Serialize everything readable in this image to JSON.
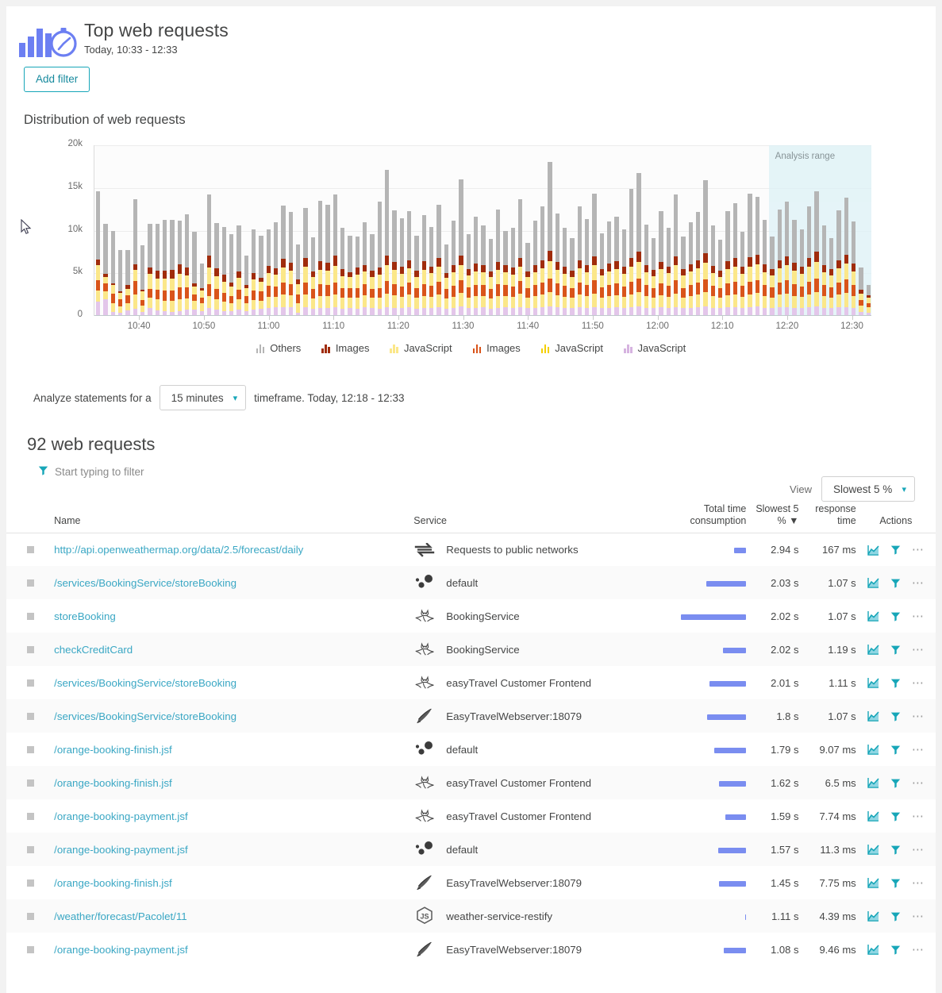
{
  "header": {
    "title": "Top web requests",
    "subtitle": "Today, 10:33 - 12:33",
    "icon": "bar-chart-stopwatch-icon",
    "add_filter_label": "Add filter"
  },
  "chart_section": {
    "title": "Distribution of web requests"
  },
  "chart_data": {
    "type": "bar",
    "stacked": true,
    "title": "Distribution of web requests",
    "xlabel": "",
    "ylabel": "",
    "ylim": [
      0,
      20000
    ],
    "ytick_labels": [
      "0",
      "5k",
      "10k",
      "15k",
      "20k"
    ],
    "ytick_values": [
      0,
      5000,
      10000,
      15000,
      20000
    ],
    "xtick_labels": [
      "10:40",
      "10:50",
      "11:00",
      "11:10",
      "11:20",
      "11:30",
      "11:40",
      "11:50",
      "12:00",
      "12:10",
      "12:20",
      "12:30"
    ],
    "grid": true,
    "legend_position": "bottom",
    "annotation": "Analysis range",
    "analysis_range": {
      "start": "12:18",
      "end": "12:33"
    },
    "series": [
      {
        "name": "JavaScript",
        "key": "s1",
        "color": "#e3c6ea"
      },
      {
        "name": "JavaScript",
        "key": "s2",
        "color": "#fbe789"
      },
      {
        "name": "Images",
        "key": "s3",
        "color": "#d9541a"
      },
      {
        "name": "JavaScript",
        "key": "s4",
        "color": "#fbe789"
      },
      {
        "name": "Images",
        "key": "s5",
        "color": "#a02c0c"
      },
      {
        "name": "Others",
        "key": "s6",
        "color": "#b5b5b5"
      }
    ],
    "legend": [
      {
        "label": "Others",
        "color": "#b5b5b5"
      },
      {
        "label": "Images",
        "color": "#a02c0c"
      },
      {
        "label": "JavaScript",
        "color": "#fbe789"
      },
      {
        "label": "Images",
        "color": "#d9541a"
      },
      {
        "label": "JavaScript",
        "color": "#f5d000"
      },
      {
        "label": "JavaScript",
        "color": "#d6b3e0"
      }
    ],
    "bars": [
      [
        1700,
        1300,
        1200,
        1750,
        700,
        7950
      ],
      [
        1950,
        900,
        1000,
        750,
        350,
        5850
      ],
      [
        500,
        1000,
        1100,
        1000,
        250,
        6150
      ],
      [
        400,
        700,
        900,
        700,
        200,
        4800
      ],
      [
        650,
        800,
        950,
        800,
        400,
        4100
      ],
      [
        800,
        1700,
        1550,
        1350,
        650,
        7600
      ],
      [
        450,
        800,
        650,
        950,
        250,
        5200
      ],
      [
        900,
        1200,
        1100,
        1700,
        800,
        5100
      ],
      [
        650,
        1300,
        1150,
        1300,
        950,
        5450
      ],
      [
        550,
        1200,
        1250,
        1400,
        950,
        5950
      ],
      [
        500,
        1300,
        1200,
        1400,
        1000,
        5850
      ],
      [
        550,
        1450,
        1350,
        1600,
        1100,
        5150
      ],
      [
        700,
        1350,
        1300,
        1400,
        900,
        6300
      ],
      [
        750,
        1000,
        800,
        850,
        400,
        6100
      ],
      [
        550,
        900,
        700,
        800,
        300,
        2900
      ],
      [
        950,
        1400,
        1350,
        2000,
        1400,
        7150
      ],
      [
        750,
        1250,
        1150,
        1500,
        900,
        5350
      ],
      [
        600,
        1100,
        1000,
        1350,
        800,
        5550
      ],
      [
        550,
        950,
        850,
        1100,
        500,
        5650
      ],
      [
        700,
        1250,
        1150,
        1400,
        750,
        5350
      ],
      [
        600,
        900,
        800,
        950,
        400,
        3450
      ],
      [
        750,
        1150,
        1050,
        1350,
        750,
        5050
      ],
      [
        800,
        1000,
        1100,
        1100,
        500,
        4900
      ],
      [
        900,
        1350,
        1250,
        1550,
        850,
        4250
      ],
      [
        1000,
        1250,
        1150,
        1400,
        750,
        5450
      ],
      [
        1050,
        1500,
        1400,
        1750,
        1000,
        6200
      ],
      [
        1000,
        1400,
        1300,
        1600,
        900,
        6000
      ],
      [
        400,
        1100,
        1000,
        1200,
        600,
        4100
      ],
      [
        1050,
        1500,
        1400,
        1800,
        1000,
        5950
      ],
      [
        850,
        1200,
        1150,
        1350,
        700,
        4000
      ],
      [
        900,
        1450,
        1350,
        1700,
        1050,
        7050
      ],
      [
        900,
        1400,
        1350,
        1700,
        900,
        6800
      ],
      [
        1000,
        1500,
        1450,
        1900,
        1200,
        7200
      ],
      [
        800,
        1300,
        1200,
        1400,
        750,
        4900
      ],
      [
        900,
        1200,
        1150,
        1300,
        600,
        4250
      ],
      [
        800,
        1300,
        1200,
        1500,
        850,
        3650
      ],
      [
        1000,
        1400,
        1300,
        1500,
        800,
        5000
      ],
      [
        900,
        1200,
        1100,
        1400,
        700,
        4300
      ],
      [
        850,
        1250,
        1200,
        1500,
        900,
        7700
      ],
      [
        1000,
        1600,
        1500,
        1850,
        1100,
        10100
      ],
      [
        950,
        1450,
        1350,
        1650,
        900,
        6100
      ],
      [
        900,
        1300,
        1250,
        1500,
        800,
        5650
      ],
      [
        1050,
        1500,
        1400,
        1650,
        950,
        5700
      ],
      [
        850,
        1250,
        1150,
        1350,
        700,
        4100
      ],
      [
        900,
        1450,
        1350,
        1700,
        1000,
        5450
      ],
      [
        950,
        1300,
        1250,
        1500,
        800,
        4600
      ],
      [
        1000,
        1550,
        1450,
        1750,
        1000,
        6300
      ],
      [
        850,
        1200,
        1100,
        1300,
        600,
        3350
      ],
      [
        900,
        1350,
        1300,
        1550,
        900,
        5200
      ],
      [
        1100,
        1600,
        1500,
        1800,
        1050,
        9000
      ],
      [
        900,
        1250,
        1200,
        1400,
        750,
        4050
      ],
      [
        950,
        1400,
        1300,
        1600,
        900,
        5450
      ],
      [
        1000,
        1350,
        1300,
        1500,
        800,
        4700
      ],
      [
        850,
        1200,
        1150,
        1350,
        700,
        3750
      ],
      [
        900,
        1450,
        1350,
        1700,
        950,
        6100
      ],
      [
        1000,
        1350,
        1250,
        1500,
        850,
        4050
      ],
      [
        900,
        1300,
        1200,
        1450,
        800,
        4700
      ],
      [
        1050,
        1550,
        1450,
        1750,
        1000,
        6900
      ],
      [
        950,
        1200,
        1100,
        1300,
        650,
        3400
      ],
      [
        900,
        1400,
        1300,
        1550,
        850,
        5150
      ],
      [
        1000,
        1500,
        1400,
        1700,
        950,
        6300
      ],
      [
        1100,
        1700,
        1600,
        2000,
        1250,
        10400
      ],
      [
        1000,
        1450,
        1350,
        1600,
        900,
        5700
      ],
      [
        950,
        1300,
        1250,
        1450,
        800,
        4600
      ],
      [
        900,
        1200,
        1150,
        1350,
        700,
        3850
      ],
      [
        1000,
        1500,
        1400,
        1700,
        950,
        6250
      ],
      [
        950,
        1350,
        1300,
        1550,
        850,
        5350
      ],
      [
        1050,
        1600,
        1500,
        1800,
        1050,
        7350
      ],
      [
        900,
        1250,
        1200,
        1400,
        750,
        4200
      ],
      [
        950,
        1400,
        1300,
        1600,
        900,
        4950
      ],
      [
        1000,
        1450,
        1350,
        1650,
        950,
        5250
      ],
      [
        900,
        1300,
        1250,
        1500,
        800,
        4350
      ],
      [
        1000,
        1550,
        1450,
        1750,
        1000,
        8100
      ],
      [
        1100,
        1700,
        1600,
        1950,
        1200,
        9200
      ],
      [
        950,
        1350,
        1300,
        1550,
        850,
        4700
      ],
      [
        900,
        1200,
        1150,
        1400,
        750,
        3700
      ],
      [
        1000,
        1450,
        1350,
        1650,
        900,
        5900
      ],
      [
        950,
        1300,
        1250,
        1500,
        800,
        4500
      ],
      [
        1050,
        1600,
        1500,
        1800,
        1050,
        7200
      ],
      [
        900,
        1250,
        1150,
        1400,
        750,
        3900
      ],
      [
        950,
        1400,
        1300,
        1550,
        850,
        4900
      ],
      [
        1000,
        1500,
        1400,
        1700,
        950,
        5600
      ],
      [
        1100,
        1650,
        1550,
        1900,
        1150,
        8600
      ],
      [
        950,
        1350,
        1250,
        1500,
        850,
        4700
      ],
      [
        900,
        1200,
        1150,
        1350,
        700,
        3600
      ],
      [
        1000,
        1450,
        1400,
        1650,
        900,
        5850
      ],
      [
        1050,
        1500,
        1450,
        1750,
        1000,
        6500
      ],
      [
        950,
        1300,
        1250,
        1450,
        800,
        4100
      ],
      [
        1000,
        1550,
        1450,
        1800,
        1050,
        7500
      ],
      [
        1100,
        1600,
        1500,
        1850,
        1100,
        6800
      ],
      [
        950,
        1350,
        1300,
        1550,
        900,
        5200
      ],
      [
        900,
        1250,
        1200,
        1400,
        750,
        3800
      ],
      [
        1000,
        1500,
        1400,
        1700,
        950,
        5950
      ],
      [
        1050,
        1600,
        1500,
        1800,
        1050,
        6400
      ],
      [
        950,
        1400,
        1350,
        1600,
        900,
        5100
      ],
      [
        900,
        1300,
        1250,
        1500,
        800,
        4400
      ],
      [
        1000,
        1550,
        1450,
        1750,
        1000,
        6100
      ],
      [
        1100,
        1700,
        1600,
        1950,
        1150,
        7100
      ],
      [
        950,
        1350,
        1300,
        1550,
        850,
        4600
      ],
      [
        900,
        1250,
        1200,
        1400,
        750,
        3650
      ],
      [
        1000,
        1500,
        1400,
        1700,
        950,
        5800
      ],
      [
        1050,
        1650,
        1550,
        1850,
        1100,
        6700
      ],
      [
        950,
        1400,
        1300,
        1600,
        900,
        4950
      ],
      [
        500,
        700,
        650,
        800,
        400,
        2650
      ],
      [
        400,
        600,
        500,
        650,
        300,
        1150
      ]
    ]
  },
  "timeframe": {
    "prefix": "Analyze statements for a",
    "value": "15 minutes",
    "suffix": "timeframe. Today, 12:18 - 12:33",
    "chevron": "chevron-down-icon"
  },
  "results": {
    "count_title": "92 web requests",
    "filter_placeholder": "Start typing to filter",
    "filter_icon": "funnel-icon",
    "view_label": "View",
    "view_value": "Slowest 5 %"
  },
  "table": {
    "columns": {
      "name": "Name",
      "service": "Service",
      "total": "Total time consumption",
      "slowest": "Slowest 5 %",
      "slowest_sort": "▼",
      "median": "Median response time",
      "actions": "Actions"
    },
    "rows": [
      {
        "name": "http://api.openweathermap.org/data/2.5/forecast/daily",
        "service": "Requests to public networks",
        "service_icon": "public-network-icon",
        "bar_pct": 18,
        "slowest": "2.94 s",
        "median": "167 ms"
      },
      {
        "name": "/services/BookingService/storeBooking",
        "service": "default",
        "service_icon": "dots-process-icon",
        "bar_pct": 58,
        "slowest": "2.03 s",
        "median": "1.07 s"
      },
      {
        "name": "storeBooking",
        "service": "BookingService",
        "service_icon": "wildfly-icon",
        "bar_pct": 95,
        "slowest": "2.02 s",
        "median": "1.07 s"
      },
      {
        "name": "checkCreditCard",
        "service": "BookingService",
        "service_icon": "wildfly-icon",
        "bar_pct": 34,
        "slowest": "2.02 s",
        "median": "1.19 s"
      },
      {
        "name": "/services/BookingService/storeBooking",
        "service": "easyTravel Customer Frontend",
        "service_icon": "wildfly-icon",
        "bar_pct": 53,
        "slowest": "2.01 s",
        "median": "1.11 s"
      },
      {
        "name": "/services/BookingService/storeBooking",
        "service": "EasyTravelWebserver:18079",
        "service_icon": "apache-feather-icon",
        "bar_pct": 57,
        "slowest": "1.8 s",
        "median": "1.07 s"
      },
      {
        "name": "/orange-booking-finish.jsf",
        "service": "default",
        "service_icon": "dots-process-icon",
        "bar_pct": 46,
        "slowest": "1.79 s",
        "median": "9.07 ms"
      },
      {
        "name": "/orange-booking-finish.jsf",
        "service": "easyTravel Customer Frontend",
        "service_icon": "wildfly-icon",
        "bar_pct": 39,
        "slowest": "1.62 s",
        "median": "6.5 ms"
      },
      {
        "name": "/orange-booking-payment.jsf",
        "service": "easyTravel Customer Frontend",
        "service_icon": "wildfly-icon",
        "bar_pct": 30,
        "slowest": "1.59 s",
        "median": "7.74 ms"
      },
      {
        "name": "/orange-booking-payment.jsf",
        "service": "default",
        "service_icon": "dots-process-icon",
        "bar_pct": 41,
        "slowest": "1.57 s",
        "median": "11.3 ms"
      },
      {
        "name": "/orange-booking-finish.jsf",
        "service": "EasyTravelWebserver:18079",
        "service_icon": "apache-feather-icon",
        "bar_pct": 39,
        "slowest": "1.45 s",
        "median": "7.75 ms"
      },
      {
        "name": "/weather/forecast/Pacolet/11",
        "service": "weather-service-restify",
        "service_icon": "nodejs-icon",
        "bar_pct": 1,
        "slowest": "1.11 s",
        "median": "4.39 ms"
      },
      {
        "name": "/orange-booking-payment.jsf",
        "service": "EasyTravelWebserver:18079",
        "service_icon": "apache-feather-icon",
        "bar_pct": 33,
        "slowest": "1.08 s",
        "median": "9.46 ms"
      }
    ],
    "row_icons": {
      "checkbox": "square-marker-icon",
      "chart": "chart-icon",
      "filter": "funnel-icon",
      "more": "more-dots-icon"
    }
  },
  "colors": {
    "accent": "#17a6b8",
    "link": "#3aa7c4",
    "bar": "#7a8df0",
    "analysis_range": "#dcf1f6"
  }
}
